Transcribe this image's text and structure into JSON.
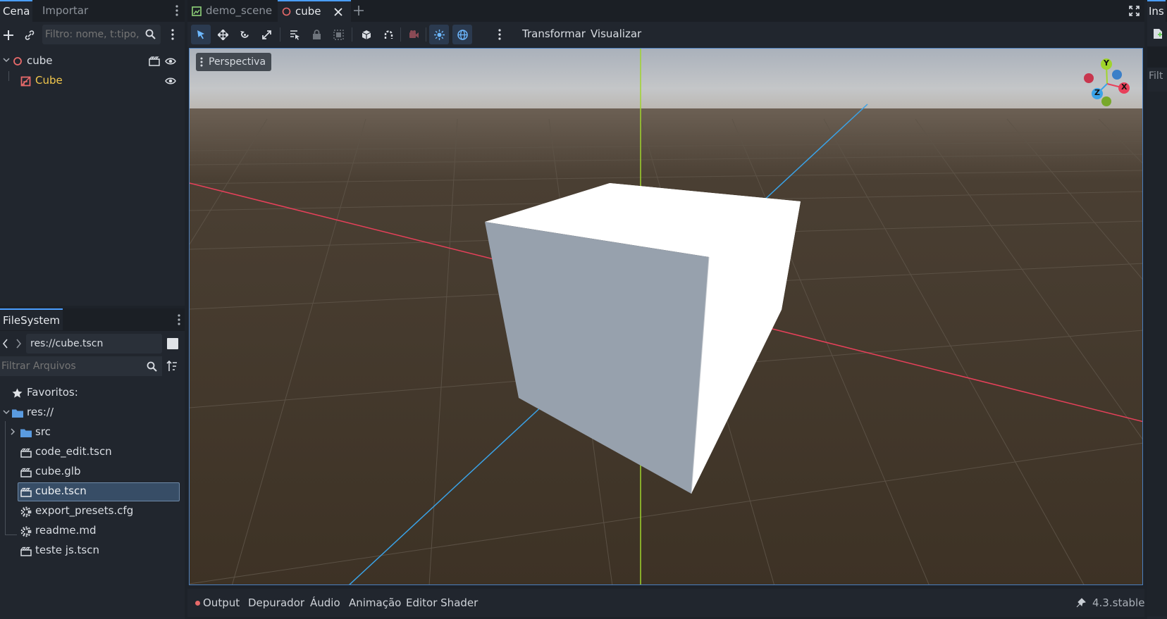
{
  "scene_dock": {
    "tabs": [
      "Cena",
      "Importar"
    ],
    "filter_placeholder": "Filtro: nome, t:tipo, g",
    "tree": [
      {
        "label": "cube",
        "icon": "node3d-icon"
      },
      {
        "label": "Cube",
        "icon": "mesh-instance-icon"
      }
    ]
  },
  "filesystem": {
    "tab": "FileSystem",
    "path": "res://cube.tscn",
    "filter_placeholder": "Filtrar Arquivos",
    "favorites_label": "Favoritos:",
    "root_label": "res://",
    "items": [
      {
        "label": "src",
        "icon": "folder-icon"
      },
      {
        "label": "code_edit.tscn",
        "icon": "scene-file-icon"
      },
      {
        "label": "cube.glb",
        "icon": "scene-file-icon"
      },
      {
        "label": "cube.tscn",
        "icon": "scene-file-icon",
        "selected": true
      },
      {
        "label": "export_presets.cfg",
        "icon": "config-file-icon"
      },
      {
        "label": "readme.md",
        "icon": "config-file-icon"
      },
      {
        "label": "teste js.tscn",
        "icon": "scene-file-icon"
      }
    ]
  },
  "editor_tabs": [
    {
      "label": "demo_scene",
      "icon": "scene-image-icon"
    },
    {
      "label": "cube",
      "icon": "node3d-icon",
      "active": true
    }
  ],
  "toolbar": {
    "transform_menu": "Transformar",
    "view_menu": "Visualizar"
  },
  "viewport": {
    "perspective_label": "Perspectiva",
    "gizmo_labels": {
      "y": "Y",
      "x": "X",
      "z": "Z"
    }
  },
  "bottom_panel": {
    "tabs": [
      "Output",
      "Depurador",
      "Áudio",
      "Animação",
      "Editor Shader"
    ],
    "version": "4.3.stable"
  },
  "inspector": {
    "tab_partial": "Ins",
    "filter_partial": "Filt"
  },
  "colors": {
    "accent": "#4a9eff",
    "selection": "#374d66",
    "axis_x": "#e8405a",
    "axis_y": "#a0d42c",
    "axis_z": "#3aa3e8",
    "node_red": "#e86a6a",
    "mesh_label": "#f2c74c"
  }
}
